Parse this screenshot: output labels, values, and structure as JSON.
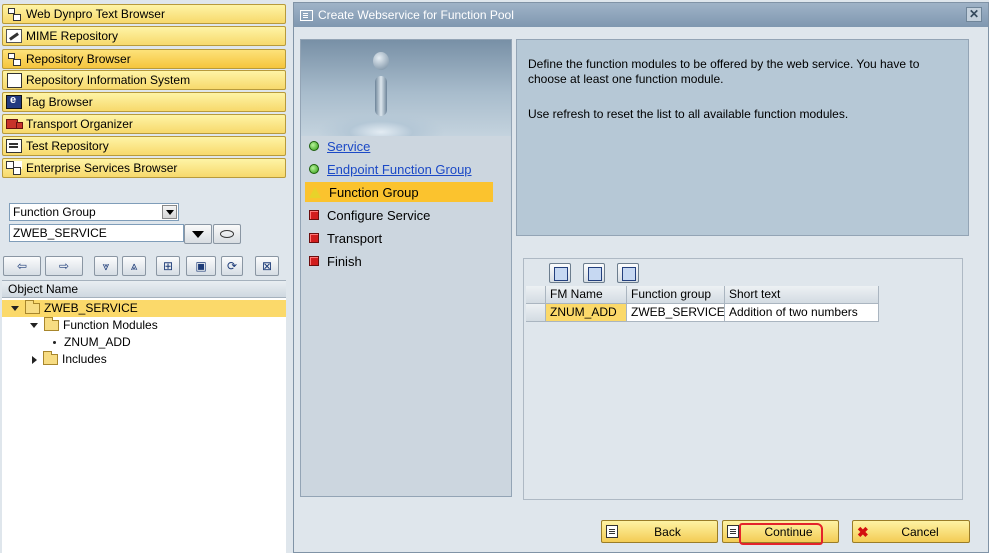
{
  "navigator": {
    "buttons": [
      {
        "label": "Web Dynpro Text Browser",
        "icon": "tree-icon"
      },
      {
        "label": "MIME Repository",
        "icon": "pencil-icon"
      },
      {
        "label": "Repository Browser",
        "icon": "tree-icon"
      },
      {
        "label": "Repository Information System",
        "icon": "info-system-icon"
      },
      {
        "label": "Tag Browser",
        "icon": "tag-icon"
      },
      {
        "label": "Transport Organizer",
        "icon": "truck-icon"
      },
      {
        "label": "Test Repository",
        "icon": "test-icon"
      },
      {
        "label": "Enterprise Services Browser",
        "icon": "enterprise-icon"
      }
    ],
    "object_type": "Function Group",
    "object_name": "ZWEB_SERVICE",
    "tree_header": "Object Name",
    "tree": [
      {
        "label": "ZWEB_SERVICE",
        "expanded": true,
        "selected": true
      },
      {
        "label": "Function Modules",
        "expanded": true
      },
      {
        "label": "ZNUM_ADD"
      },
      {
        "label": "Includes",
        "expanded": false
      }
    ]
  },
  "dialog": {
    "title": "Create Webservice for Function Pool",
    "close_glyph": "✕",
    "steps": [
      {
        "label": "Service",
        "status": "done",
        "link": true
      },
      {
        "label": "Endpoint Function Group",
        "status": "done",
        "link": true
      },
      {
        "label": "Function Group",
        "status": "current",
        "link": false
      },
      {
        "label": "Configure Service",
        "status": "pending",
        "link": false
      },
      {
        "label": "Transport",
        "status": "pending",
        "link": false
      },
      {
        "label": "Finish",
        "status": "pending",
        "link": false
      }
    ],
    "info_line1": "Define the function modules to be offered by the web service. You have to choose at least one function module.",
    "info_line2": "Use refresh to reset the list to all available function modules.",
    "grid": {
      "columns": [
        "FM Name",
        "Function group",
        "Short text"
      ],
      "rows": [
        [
          "ZNUM_ADD",
          "ZWEB_SERVICE",
          "Addition of  two numbers"
        ]
      ]
    },
    "buttons": {
      "back": "Back",
      "continue": "Continue",
      "cancel": "Cancel"
    },
    "highlight_color": "#e4232b"
  }
}
